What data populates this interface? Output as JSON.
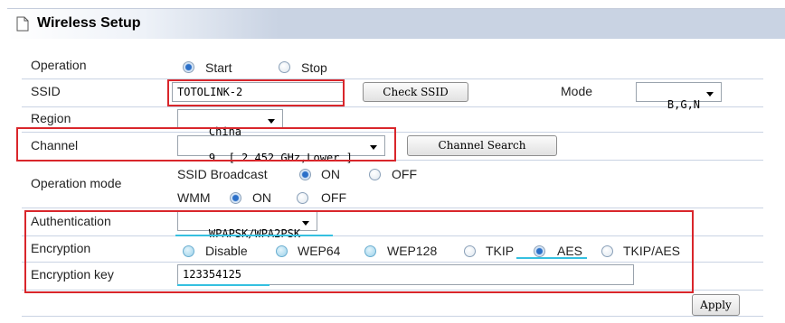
{
  "header": {
    "title": "Wireless Setup",
    "icon": "page-icon"
  },
  "operation": {
    "label": "Operation",
    "options": [
      "Start",
      "Stop"
    ],
    "selected": "Start"
  },
  "ssid": {
    "label": "SSID",
    "value": "TOTOLINK-2",
    "check_button": "Check SSID"
  },
  "mode": {
    "label": "Mode",
    "value": "B,G,N"
  },
  "region": {
    "label": "Region",
    "value": "China"
  },
  "channel": {
    "label": "Channel",
    "value": "9  [ 2.452 GHz,Lower ]",
    "search_button": "Channel Search"
  },
  "operation_mode": {
    "label": "Operation mode",
    "ssid_broadcast_label": "SSID Broadcast",
    "ssid_broadcast_options": [
      "ON",
      "OFF"
    ],
    "ssid_broadcast_selected": "ON",
    "wmm_label": "WMM",
    "wmm_options": [
      "ON",
      "OFF"
    ],
    "wmm_selected": "ON"
  },
  "authentication": {
    "label": "Authentication",
    "value": "WPAPSK/WPA2PSK"
  },
  "encryption": {
    "label": "Encryption",
    "options": [
      "Disable",
      "WEP64",
      "WEP128",
      "TKIP",
      "AES",
      "TKIP/AES"
    ],
    "selected": "AES"
  },
  "encryption_key": {
    "label": "Encryption key",
    "value": "123354125"
  },
  "apply_button": "Apply",
  "colors": {
    "highlight_box": "#d9262b",
    "underline": "#35c0e0",
    "header_bar": "#c9d3e3"
  }
}
